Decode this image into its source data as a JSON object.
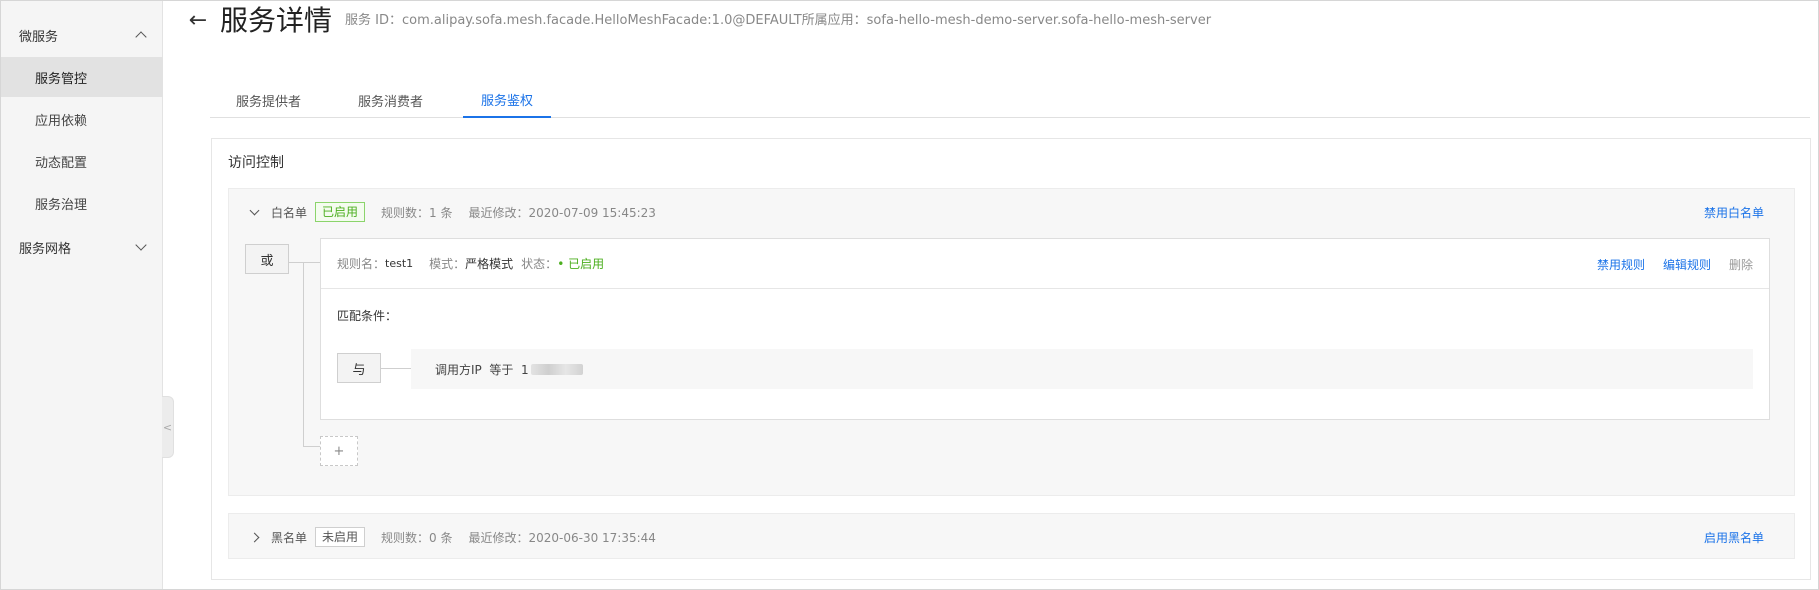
{
  "sidebar": {
    "groups": [
      {
        "label": "微服务",
        "expanded": true
      },
      {
        "label": "服务网格",
        "expanded": false
      }
    ],
    "items": [
      {
        "label": "服务管控",
        "active": true
      },
      {
        "label": "应用依赖",
        "active": false
      },
      {
        "label": "动态配置",
        "active": false
      },
      {
        "label": "服务治理",
        "active": false
      }
    ],
    "collapse_handle": "<"
  },
  "header": {
    "back_icon": "←",
    "title": "服务详情",
    "service_info": "服务 ID：com.alipay.sofa.mesh.facade.HelloMeshFacade:1.0@DEFAULT所属应用：sofa-hello-mesh-demo-server.sofa-hello-mesh-server"
  },
  "tabs": [
    {
      "label": "服务提供者",
      "active": false
    },
    {
      "label": "服务消费者",
      "active": false
    },
    {
      "label": "服务鉴权",
      "active": true
    }
  ],
  "access_control": {
    "title": "访问控制",
    "whitelist": {
      "name": "白名单",
      "status": "已启用",
      "rule_count": "规则数：1 条",
      "last_modified": "最近修改：2020-07-09 15:45:23",
      "action": "禁用白名单",
      "or_label": "或",
      "rule": {
        "name_label": "规则名：",
        "name": "test1",
        "mode_label": "模式：",
        "mode": "严格模式",
        "status_label": "状态：",
        "status": "• 已启用",
        "actions": [
          "禁用规则",
          "编辑规则",
          "删除"
        ],
        "match_label": "匹配条件：",
        "and_label": "与",
        "condition": "调用方IP  等于  1"
      },
      "add_label": "+"
    },
    "blacklist": {
      "name": "黑名单",
      "status": "未启用",
      "rule_count": "规则数：0 条",
      "last_modified": "最近修改：2020-06-30 17:35:44",
      "action": "启用黑名单"
    }
  },
  "colors": {
    "accent": "#1b73e8",
    "enabled": "#4caf1f",
    "sidebar_bg": "#f5f5f5"
  }
}
